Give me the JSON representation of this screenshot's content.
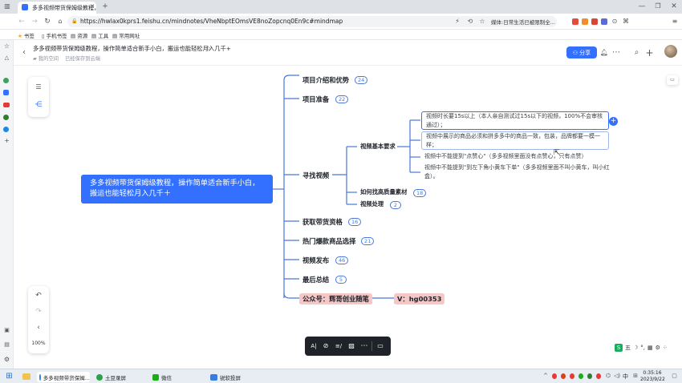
{
  "browser": {
    "tab_title": "多多视频带货保姆级教程，操作简...",
    "url": "https://hwlax0kprs1.feishu.cn/mindnotes/VheNbptEOmsVE8noZopcnq0En9c#mindmap",
    "search_hint": "媒体:日常生活已被限制全...",
    "bookmarks": [
      "书签",
      "手机书签",
      "资源",
      "工具",
      "常用网址"
    ]
  },
  "doc": {
    "title": "多多视频带货保姆级教程，操作简单适合新手小白，搬运也能轻松月入几千+",
    "location": "我的空间",
    "save_status": "已经保存到云端",
    "share_label": "分享"
  },
  "mindmap": {
    "root": "多多视频带货保姆级教程，操作简单适合新手小白，搬运也能轻松月入几千＋",
    "branches": [
      {
        "label": "项目介绍和优势",
        "count": "24"
      },
      {
        "label": "项目准备",
        "count": "22"
      },
      {
        "label": "寻找视频",
        "count": ""
      },
      {
        "label": "获取带货资格",
        "count": "16"
      },
      {
        "label": "热门爆款商品选择",
        "count": "21"
      },
      {
        "label": "视频发布",
        "count": "46"
      },
      {
        "label": "最后总结",
        "count": "5"
      },
      {
        "label": "公众号：辉哥创业随笔",
        "count": ""
      }
    ],
    "find_video": {
      "subs": [
        {
          "label": "视频基本要求",
          "count": ""
        },
        {
          "label": "如何找高质量素材",
          "count": "18"
        },
        {
          "label": "视频处理",
          "count": "2"
        }
      ],
      "requirements": [
        "视频时长要15s以上（本人亲自测试过15s以下的视频，100%不会审核通过）；",
        "视频中展示的商品必须和拼多多中的商品一致，包装，品牌都要一模一样；",
        "视频中不能提到\"点赞心\"（多多视频里面没有点赞心，只有点赞）",
        "视频中不能提到\"到左下角小黄车下单\"（多多视频里面不叫小黄车，叫小红盒）。"
      ]
    },
    "wechat_id": "V：hg00353"
  },
  "zoom": "100%",
  "taskbar": {
    "apps": [
      "多多视频带货保姆...",
      "土豆录屏",
      "微信",
      "锐软投屏"
    ],
    "time": "0:35:16",
    "date": "2023/9/22",
    "lang": "中"
  },
  "colors": {
    "accent": "#3370ff",
    "root_bg": "#3370ff",
    "line": "#4a78d6",
    "highlight_bg": "#f6c7c7"
  }
}
